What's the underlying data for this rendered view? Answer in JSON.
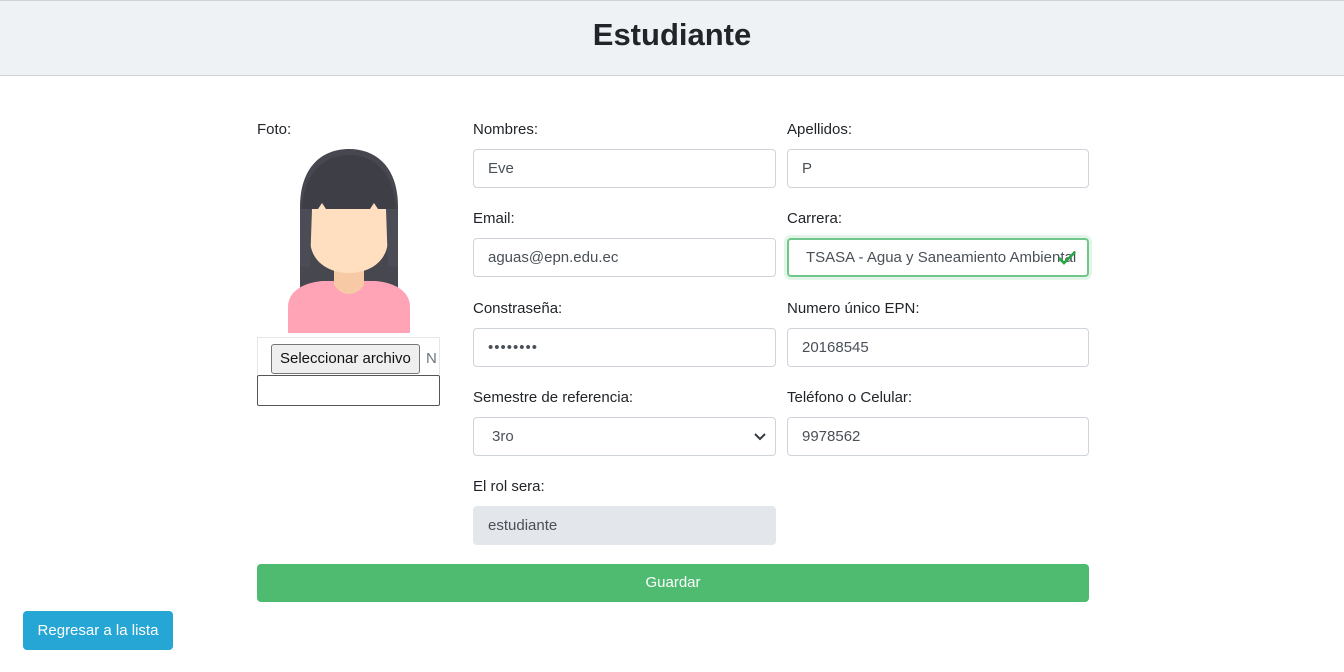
{
  "header": {
    "title": "Estudiante"
  },
  "form": {
    "foto_label": "Foto:",
    "file": {
      "button_label": "Seleccionar archivo",
      "trailing_text": "N"
    },
    "nombres": {
      "label": "Nombres:",
      "value": "Eve"
    },
    "apellidos": {
      "label": "Apellidos:",
      "value": "P"
    },
    "email": {
      "label": "Email:",
      "value": "aguas@epn.edu.ec"
    },
    "carrera": {
      "label": "Carrera:",
      "value": "TSASA - Agua y Saneamiento Ambiental",
      "status_color": "#28a745"
    },
    "contrasena": {
      "label": "Constraseña:",
      "value": "••••••••"
    },
    "numero_unico": {
      "label": "Numero único EPN:",
      "value": "20168545"
    },
    "semestre": {
      "label": "Semestre de referencia:",
      "selected": "3ro",
      "icon": "chevron-down-icon"
    },
    "telefono": {
      "label": "Teléfono o Celular:",
      "value": "9978562"
    },
    "rol": {
      "label": "El rol sera:",
      "value": "estudiante"
    }
  },
  "actions": {
    "save_label": "Guardar",
    "save_color": "#4fbb71",
    "back_label": "Regresar a la lista",
    "back_color": "#25a6d5"
  }
}
